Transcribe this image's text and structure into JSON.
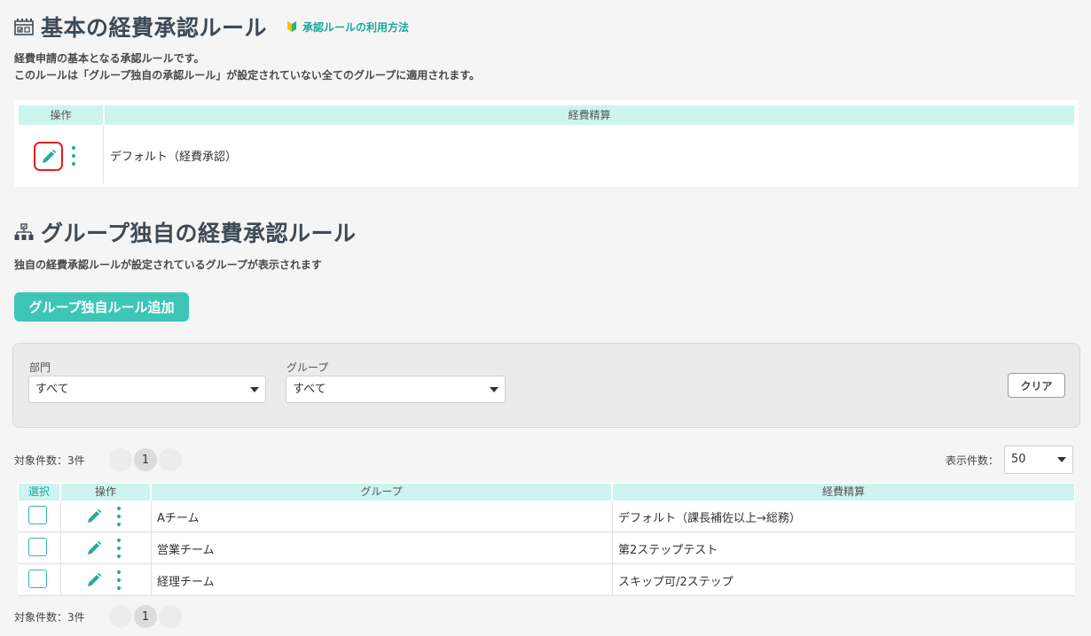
{
  "basic_section": {
    "title": "基本の経費承認ルール",
    "help_link": "承認ルールの利用方法",
    "desc_line1": "経費申請の基本となる承認ルールです。",
    "desc_line2": "このルールは「グループ独自の承認ルール」が設定されていない全てのグループに適用されます。",
    "table": {
      "col_action": "操作",
      "col_expense": "経費精算",
      "row_value": "デフォルト（経費承認）"
    }
  },
  "group_section": {
    "title": "グループ独自の経費承認ルール",
    "desc": "独自の経費承認ルールが設定されているグループが表示されます",
    "add_button": "グループ独自ルール追加"
  },
  "filter": {
    "department_label": "部門",
    "department_value": "すべて",
    "group_label": "グループ",
    "group_value": "すべて",
    "clear_button": "クリア"
  },
  "list": {
    "count_text": "対象件数：3件",
    "current_page": "1",
    "per_page_label": "表示件数：",
    "per_page_value": "50",
    "headers": {
      "select": "選択",
      "action": "操作",
      "group": "グループ",
      "expense": "経費精算"
    },
    "rows": [
      {
        "group": "Aチーム",
        "expense": "デフォルト（課長補佐以上→総務）"
      },
      {
        "group": "営業チーム",
        "expense": "第2ステップテスト"
      },
      {
        "group": "経理チーム",
        "expense": "スキップ可/2ステップ"
      }
    ]
  },
  "colors": {
    "accent": "#3dc6b8",
    "header_bg": "#cdf4ef",
    "highlight": "#e0201f"
  }
}
